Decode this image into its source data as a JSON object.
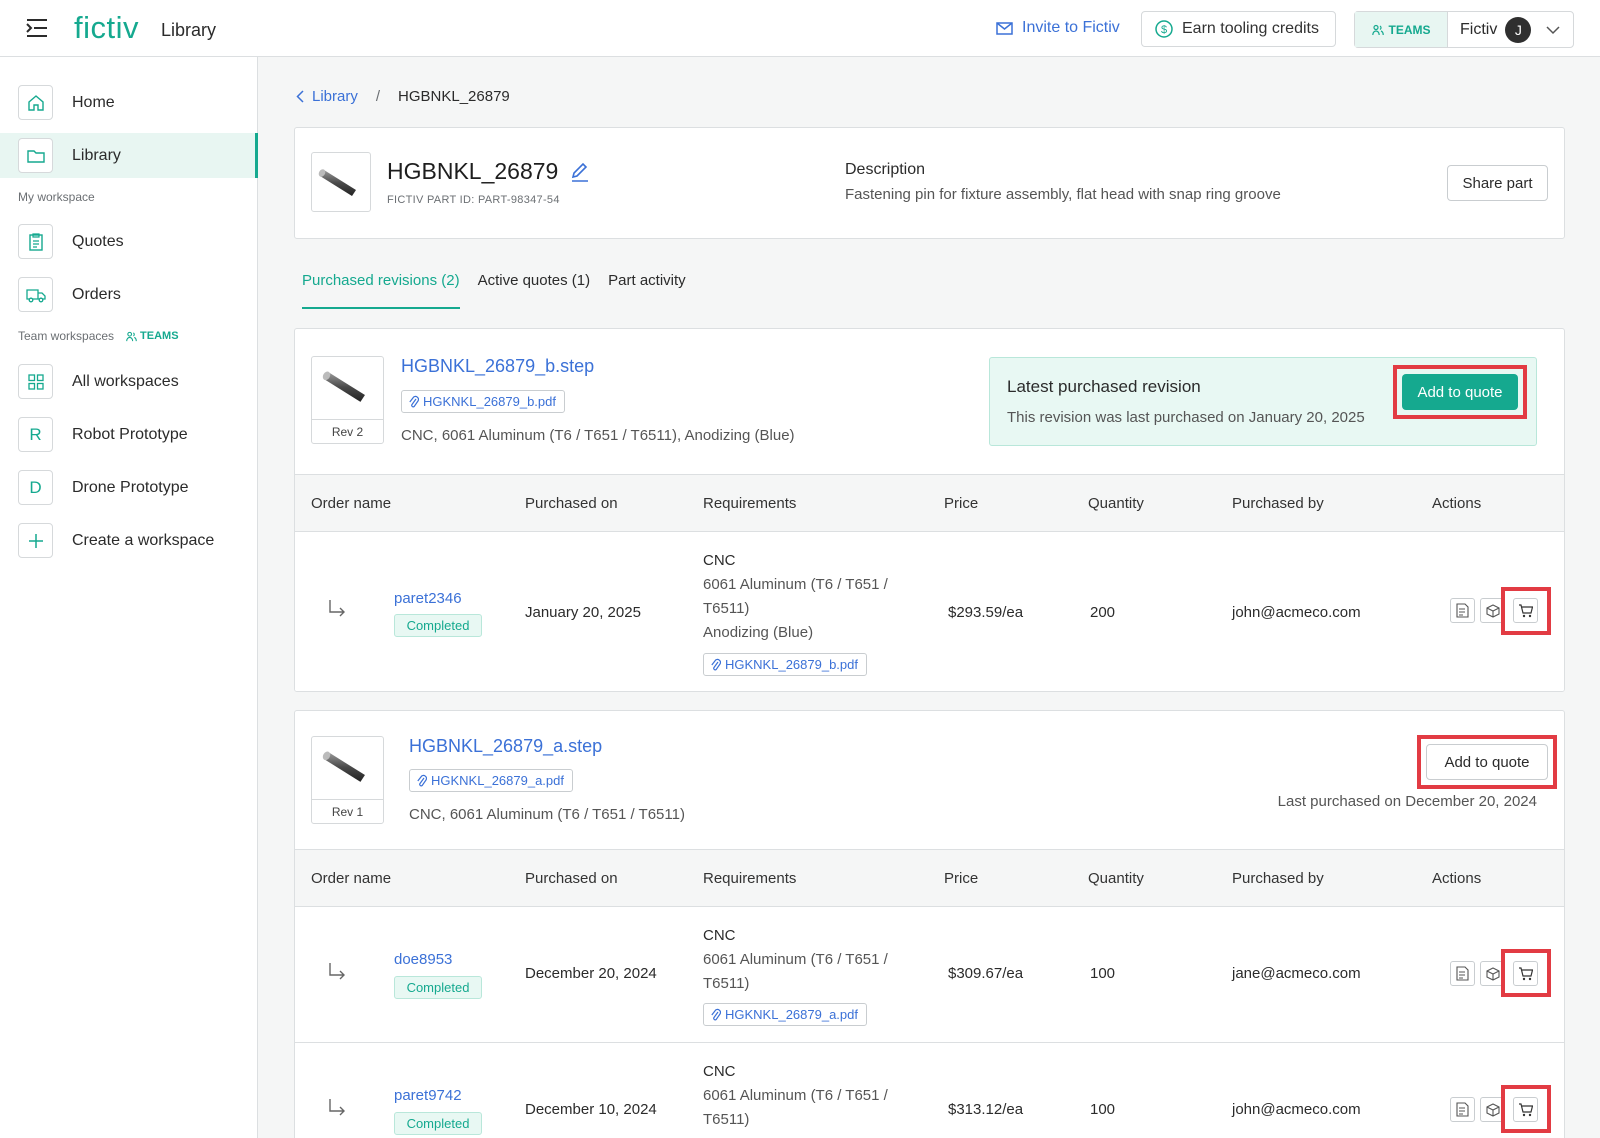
{
  "header": {
    "brand": "fictiv",
    "app_title": "Library",
    "invite_label": "Invite to Fictiv",
    "earn_label": "Earn tooling credits",
    "teams_tag": "TEAMS",
    "org_name": "Fictiv",
    "avatar_initial": "J"
  },
  "sidebar": {
    "items": [
      {
        "label": "Home"
      },
      {
        "label": "Library"
      }
    ],
    "my_workspace_label": "My workspace",
    "workspace_items": [
      {
        "label": "Quotes"
      },
      {
        "label": "Orders"
      }
    ],
    "team_workspaces_label": "Team workspaces",
    "teams_tag": "TEAMS",
    "team_items": [
      {
        "label": "All workspaces",
        "icon": "grid-icon"
      },
      {
        "label": "Robot Prototype",
        "initial": "R"
      },
      {
        "label": "Drone Prototype",
        "initial": "D"
      },
      {
        "label": "Create a workspace",
        "icon": "plus-icon"
      }
    ]
  },
  "breadcrumb": {
    "parent": "Library",
    "separator": "/",
    "current": "HGBNKL_26879"
  },
  "part": {
    "name": "HGBNKL_26879",
    "id_label": "FICTIV PART ID: PART-98347-54",
    "description_title": "Description",
    "description": "Fastening pin for fixture assembly, flat head with snap ring groove",
    "share_label": "Share part"
  },
  "tabs": [
    {
      "label": "Purchased revisions (2)",
      "active": true
    },
    {
      "label": "Active quotes (1)",
      "active": false
    },
    {
      "label": "Part activity",
      "active": false
    }
  ],
  "table_headers": [
    "Order name",
    "Purchased on",
    "Requirements",
    "Price",
    "Quantity",
    "Purchased by",
    "Actions"
  ],
  "revisions": [
    {
      "rev_label": "Rev 2",
      "file": "HGBNKL_26879_b.step",
      "pdf": "HGKNKL_26879_b.pdf",
      "spec": "CNC, 6061 Aluminum (T6 / T651 / T6511), Anodizing (Blue)",
      "latest_title": "Latest purchased revision",
      "latest_sub": "This revision was last purchased on January 20, 2025",
      "add_label": "Add to quote",
      "orders": [
        {
          "name": "paret2346",
          "status": "Completed",
          "date": "January 20, 2025",
          "req_process": "CNC",
          "req_material_1": "6061 Aluminum (T6 / T651 /",
          "req_material_2": "T6511)",
          "req_finish": "Anodizing (Blue)",
          "req_pdf": "HGKNKL_26879_b.pdf",
          "price": "$293.59/ea",
          "qty": "200",
          "by": "john@acmeco.com"
        }
      ]
    },
    {
      "rev_label": "Rev 1",
      "file": "HGBNKL_26879_a.step",
      "pdf": "HGKNKL_26879_a.pdf",
      "spec": "CNC, 6061 Aluminum (T6 / T651 / T6511)",
      "add_label": "Add to quote",
      "last_purchased": "Last purchased on December 20, 2024",
      "orders": [
        {
          "name": "doe8953",
          "status": "Completed",
          "date": "December 20, 2024",
          "req_process": "CNC",
          "req_material_1": "6061 Aluminum (T6 / T651 /",
          "req_material_2": "T6511)",
          "req_pdf": "HGKNKL_26879_a.pdf",
          "price": "$309.67/ea",
          "qty": "100",
          "by": "jane@acmeco.com"
        },
        {
          "name": "paret9742",
          "status": "Completed",
          "date": "December 10, 2024",
          "req_process": "CNC",
          "req_material_1": "6061 Aluminum (T6 / T651 /",
          "req_material_2": "T6511)",
          "price": "$313.12/ea",
          "qty": "100",
          "by": "john@acmeco.com"
        }
      ]
    }
  ],
  "colors": {
    "accent": "#15a98f",
    "link": "#3b71d7",
    "highlight": "#e23b43"
  }
}
